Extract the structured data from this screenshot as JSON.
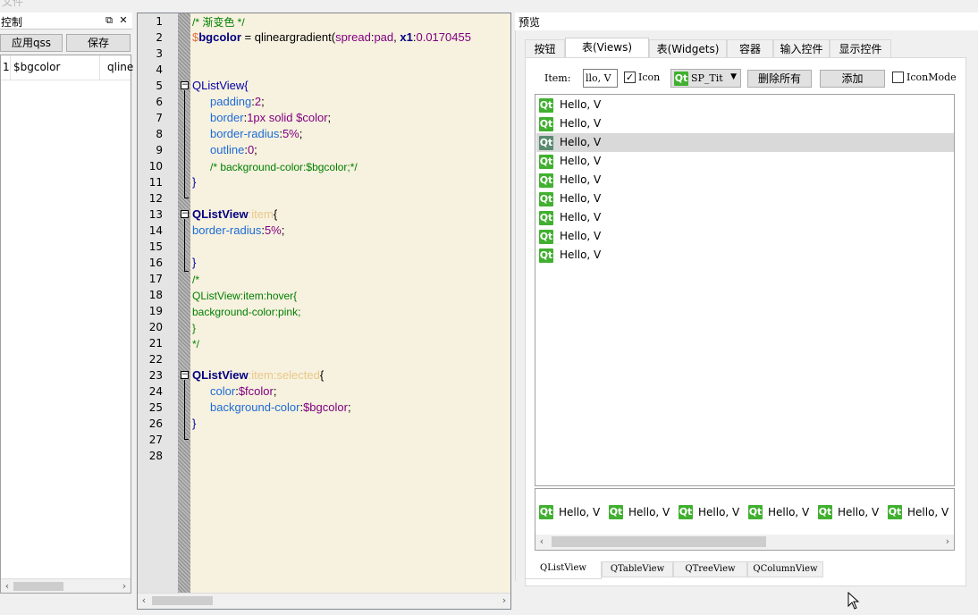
{
  "menubar": {
    "file_label": "文件"
  },
  "control_dock": {
    "title": "控制",
    "float_icon": "float-icon",
    "close_icon": "close-icon",
    "apply_label": "应用qss",
    "save_label": "保存",
    "variables": [
      {
        "index": "1",
        "name": "$bgcolor",
        "value": "qline"
      }
    ]
  },
  "editor": {
    "line_numbers": [
      "1",
      "2",
      "3",
      "4",
      "5",
      "6",
      "7",
      "8",
      "9",
      "10",
      "11",
      "12",
      "13",
      "14",
      "15",
      "16",
      "17",
      "18",
      "19",
      "20",
      "21",
      "22",
      "23",
      "24",
      "25",
      "26",
      "27",
      "28"
    ],
    "l1": "/* 渐变色 */",
    "l2a": "$",
    "l2b": "bgcolor",
    "l2c": " = ",
    "l2d": "qlineargradient(",
    "l2e": "spread",
    "l2f": ":",
    "l2g": "pad",
    "l2h": ", ",
    "l2i": "x1",
    "l2j": ":",
    "l2k": "0.0170455",
    "l5": "QListView{",
    "l6a": "padding",
    "l6b": ":",
    "l6c": "2",
    "l6d": ";",
    "l7a": "border",
    "l7b": ":",
    "l7c": "1px solid ",
    "l7d": "$color",
    "l7e": ";",
    "l8a": "border-radius",
    "l8b": ":",
    "l8c": "5%",
    "l8d": ";",
    "l9a": "outline",
    "l9b": ":",
    "l9c": "0",
    "l9d": ";",
    "l10": "/* background-color:$bgcolor;*/",
    "l11": "}",
    "l13a": "QListView",
    "l13b": ":",
    "l13c": "item",
    "l13d": "{",
    "l14a": "border-radius",
    "l14b": ":",
    "l14c": "5%",
    "l14d": ";",
    "l16": "}",
    "l17": "/*",
    "l18": "QListView:item:hover{",
    "l19": "background-color:pink;",
    "l20": "}",
    "l21": "*/",
    "l23a": "QListView",
    "l23b": ":",
    "l23c": "item",
    "l23d": ":",
    "l23e": "selected",
    "l23f": "{",
    "l24a": "color",
    "l24b": ":",
    "l24c": "$fcolor",
    "l24d": ";",
    "l25a": "background-color",
    "l25b": ":",
    "l25c": "$bgcolor",
    "l25d": ";",
    "l26": "}"
  },
  "preview": {
    "title": "预览",
    "tabs": [
      "按钮",
      "表(Views)",
      "表(Widgets)",
      "容器",
      "输入控件",
      "显示控件"
    ],
    "active_tab": 1,
    "toolbar": {
      "item_label": "Item:",
      "item_value": "llo, V",
      "icon_label": "Icon",
      "icon_checked": true,
      "combo_value": "SP_Tit",
      "delete_all_label": "删除所有",
      "add_label": "添加",
      "iconmode_label": "IconMode",
      "iconmode_checked": false
    },
    "list_items": [
      "Hello, V",
      "Hello, V",
      "Hello, V",
      "Hello, V",
      "Hello, V",
      "Hello, V",
      "Hello, V",
      "Hello, V",
      "Hello, V"
    ],
    "selected_index": 2,
    "icon_items": [
      "Hello, V",
      "Hello, V",
      "Hello, V",
      "Hello, V",
      "Hello, V",
      "Hello, V"
    ],
    "qt_glyph": "Qt",
    "bottom_tabs": [
      "QListView",
      "QTableView",
      "QTreeView",
      "QColumnView"
    ],
    "active_bottom_tab": 0
  },
  "colors": {
    "editor_bg": "#f7f1df",
    "comment": "#008000",
    "selector": "#000080",
    "property": "#1c6bd6",
    "value": "#800080",
    "qt_green": "#41b030",
    "selection": "#d9d9d9"
  }
}
